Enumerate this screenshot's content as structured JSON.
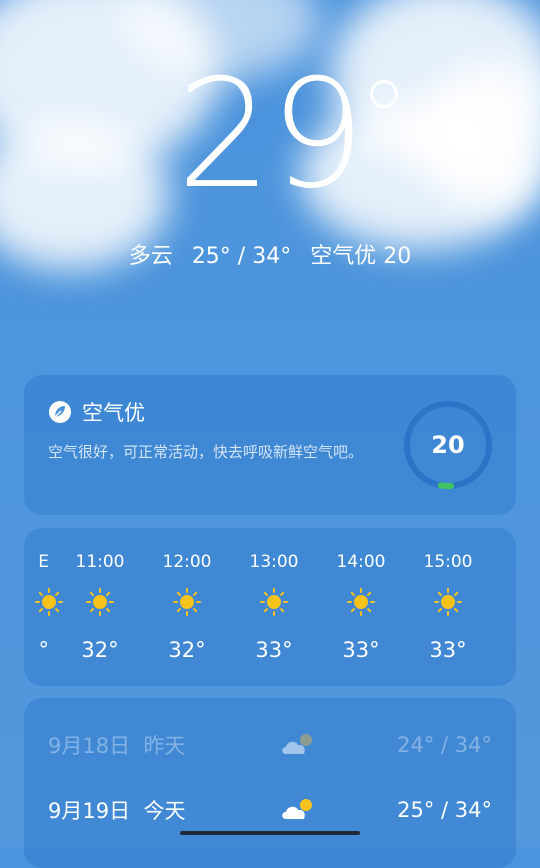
{
  "current": {
    "temperature": "29",
    "condition": "多云",
    "range": "25° / 34°",
    "air_quality": "空气优 20"
  },
  "aqi": {
    "title": "空气优",
    "description": "空气很好，可正常活动，快去呼吸新鲜空气吧。",
    "value": "20",
    "level": 0.04,
    "accent": "#43c463",
    "icon": "leaf-icon"
  },
  "hourly": [
    {
      "time": "E",
      "temp": "°",
      "icon": "sun-icon"
    },
    {
      "time": "11:00",
      "temp": "32°",
      "icon": "sun-icon"
    },
    {
      "time": "12:00",
      "temp": "32°",
      "icon": "sun-icon"
    },
    {
      "time": "13:00",
      "temp": "33°",
      "icon": "sun-icon"
    },
    {
      "time": "14:00",
      "temp": "33°",
      "icon": "sun-icon"
    },
    {
      "time": "15:00",
      "temp": "33°",
      "icon": "sun-icon"
    }
  ],
  "daily": [
    {
      "date": "9月18日",
      "label": "昨天",
      "icon": "cloudy-icon",
      "range": "24° / 34°",
      "faded": true
    },
    {
      "date": "9月19日",
      "label": "今天",
      "icon": "partly-cloudy-icon",
      "range": "25° / 34°",
      "faded": false
    }
  ],
  "colors": {
    "sun": "#f8c21c",
    "background": "#4a93dd"
  }
}
